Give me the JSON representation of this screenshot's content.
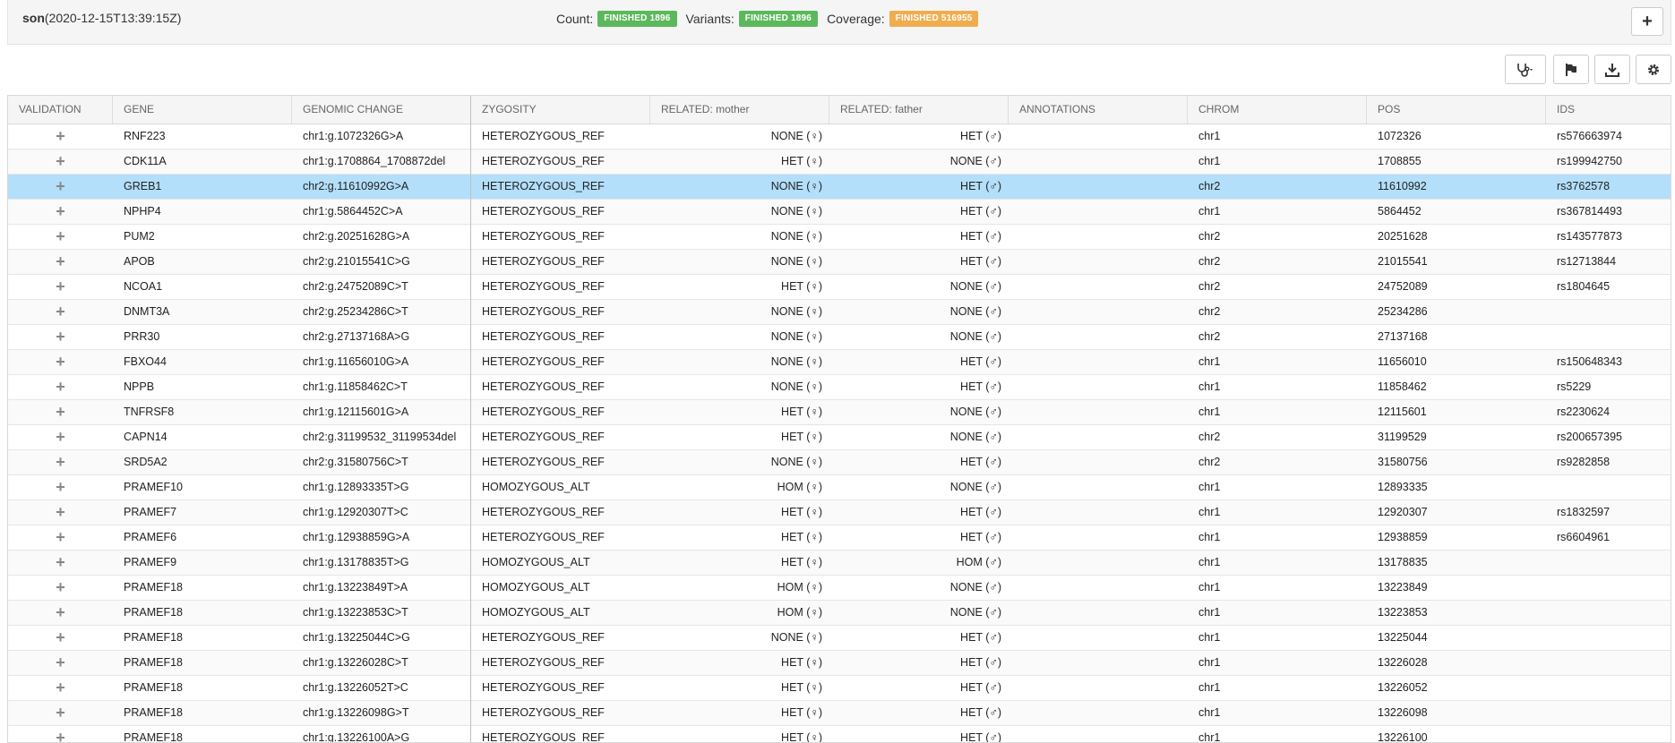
{
  "header": {
    "sample_name": "son",
    "sample_date": "(2020-12-15T13:39:15Z)",
    "statuses": [
      {
        "label": "Count:",
        "badge": "FINISHED 1896",
        "color": "#5cb85c"
      },
      {
        "label": "Variants:",
        "badge": "FINISHED 1896",
        "color": "#5cb85c"
      },
      {
        "label": "Coverage:",
        "badge": "FINISHED 516955",
        "color": "#f0ad4e"
      }
    ],
    "add_icon": "plus-icon"
  },
  "toolbar": {
    "buttons": [
      {
        "name": "stethoscope-dropdown-button",
        "icon": "stethoscope-icon"
      },
      {
        "name": "flag-button",
        "icon": "flag-icon"
      },
      {
        "name": "download-button",
        "icon": "download-icon"
      },
      {
        "name": "settings-button",
        "icon": "gear-icon"
      }
    ]
  },
  "table": {
    "columns": [
      "VALIDATION",
      "GENE",
      "GENOMIC CHANGE",
      "ZYGOSITY",
      "RELATED: mother",
      "RELATED: father",
      "ANNOTATIONS",
      "CHROM",
      "POS",
      "IDS"
    ],
    "selected_row": 2,
    "rows": [
      {
        "gene": "RNF223",
        "change": "chr1:g.1072326G>A",
        "zyg": "HETEROZYGOUS_REF",
        "mother": "NONE (♀)",
        "father": "HET (♂)",
        "chrom": "chr1",
        "pos": "1072326",
        "ids": "rs576663974"
      },
      {
        "gene": "CDK11A",
        "change": "chr1:g.1708864_1708872del",
        "zyg": "HETEROZYGOUS_REF",
        "mother": "HET (♀)",
        "father": "NONE (♂)",
        "chrom": "chr1",
        "pos": "1708855",
        "ids": "rs199942750"
      },
      {
        "gene": "GREB1",
        "change": "chr2:g.11610992G>A",
        "zyg": "HETEROZYGOUS_REF",
        "mother": "NONE (♀)",
        "father": "HET (♂)",
        "chrom": "chr2",
        "pos": "11610992",
        "ids": "rs3762578"
      },
      {
        "gene": "NPHP4",
        "change": "chr1:g.5864452C>A",
        "zyg": "HETEROZYGOUS_REF",
        "mother": "NONE (♀)",
        "father": "HET (♂)",
        "chrom": "chr1",
        "pos": "5864452",
        "ids": "rs367814493"
      },
      {
        "gene": "PUM2",
        "change": "chr2:g.20251628G>A",
        "zyg": "HETEROZYGOUS_REF",
        "mother": "NONE (♀)",
        "father": "HET (♂)",
        "chrom": "chr2",
        "pos": "20251628",
        "ids": "rs143577873"
      },
      {
        "gene": "APOB",
        "change": "chr2:g.21015541C>G",
        "zyg": "HETEROZYGOUS_REF",
        "mother": "NONE (♀)",
        "father": "HET (♂)",
        "chrom": "chr2",
        "pos": "21015541",
        "ids": "rs12713844"
      },
      {
        "gene": "NCOA1",
        "change": "chr2:g.24752089C>T",
        "zyg": "HETEROZYGOUS_REF",
        "mother": "HET (♀)",
        "father": "NONE (♂)",
        "chrom": "chr2",
        "pos": "24752089",
        "ids": "rs1804645"
      },
      {
        "gene": "DNMT3A",
        "change": "chr2:g.25234286C>T",
        "zyg": "HETEROZYGOUS_REF",
        "mother": "NONE (♀)",
        "father": "NONE (♂)",
        "chrom": "chr2",
        "pos": "25234286",
        "ids": ""
      },
      {
        "gene": "PRR30",
        "change": "chr2:g.27137168A>G",
        "zyg": "HETEROZYGOUS_REF",
        "mother": "NONE (♀)",
        "father": "NONE (♂)",
        "chrom": "chr2",
        "pos": "27137168",
        "ids": ""
      },
      {
        "gene": "FBXO44",
        "change": "chr1:g.11656010G>A",
        "zyg": "HETEROZYGOUS_REF",
        "mother": "NONE (♀)",
        "father": "HET (♂)",
        "chrom": "chr1",
        "pos": "11656010",
        "ids": "rs150648343"
      },
      {
        "gene": "NPPB",
        "change": "chr1:g.11858462C>T",
        "zyg": "HETEROZYGOUS_REF",
        "mother": "NONE (♀)",
        "father": "HET (♂)",
        "chrom": "chr1",
        "pos": "11858462",
        "ids": "rs5229"
      },
      {
        "gene": "TNFRSF8",
        "change": "chr1:g.12115601G>A",
        "zyg": "HETEROZYGOUS_REF",
        "mother": "HET (♀)",
        "father": "NONE (♂)",
        "chrom": "chr1",
        "pos": "12115601",
        "ids": "rs2230624"
      },
      {
        "gene": "CAPN14",
        "change": "chr2:g.31199532_31199534del",
        "zyg": "HETEROZYGOUS_REF",
        "mother": "HET (♀)",
        "father": "NONE (♂)",
        "chrom": "chr2",
        "pos": "31199529",
        "ids": "rs200657395"
      },
      {
        "gene": "SRD5A2",
        "change": "chr2:g.31580756C>T",
        "zyg": "HETEROZYGOUS_REF",
        "mother": "NONE (♀)",
        "father": "HET (♂)",
        "chrom": "chr2",
        "pos": "31580756",
        "ids": "rs9282858"
      },
      {
        "gene": "PRAMEF10",
        "change": "chr1:g.12893335T>G",
        "zyg": "HOMOZYGOUS_ALT",
        "mother": "HOM (♀)",
        "father": "NONE (♂)",
        "chrom": "chr1",
        "pos": "12893335",
        "ids": ""
      },
      {
        "gene": "PRAMEF7",
        "change": "chr1:g.12920307T>C",
        "zyg": "HETEROZYGOUS_REF",
        "mother": "HET (♀)",
        "father": "HET (♂)",
        "chrom": "chr1",
        "pos": "12920307",
        "ids": "rs1832597"
      },
      {
        "gene": "PRAMEF6",
        "change": "chr1:g.12938859G>A",
        "zyg": "HETEROZYGOUS_REF",
        "mother": "HET (♀)",
        "father": "HET (♂)",
        "chrom": "chr1",
        "pos": "12938859",
        "ids": "rs6604961"
      },
      {
        "gene": "PRAMEF9",
        "change": "chr1:g.13178835T>G",
        "zyg": "HOMOZYGOUS_ALT",
        "mother": "HET (♀)",
        "father": "HOM (♂)",
        "chrom": "chr1",
        "pos": "13178835",
        "ids": ""
      },
      {
        "gene": "PRAMEF18",
        "change": "chr1:g.13223849T>A",
        "zyg": "HOMOZYGOUS_ALT",
        "mother": "HOM (♀)",
        "father": "NONE (♂)",
        "chrom": "chr1",
        "pos": "13223849",
        "ids": ""
      },
      {
        "gene": "PRAMEF18",
        "change": "chr1:g.13223853C>T",
        "zyg": "HOMOZYGOUS_ALT",
        "mother": "HOM (♀)",
        "father": "NONE (♂)",
        "chrom": "chr1",
        "pos": "13223853",
        "ids": ""
      },
      {
        "gene": "PRAMEF18",
        "change": "chr1:g.13225044C>G",
        "zyg": "HETEROZYGOUS_REF",
        "mother": "NONE (♀)",
        "father": "HET (♂)",
        "chrom": "chr1",
        "pos": "13225044",
        "ids": ""
      },
      {
        "gene": "PRAMEF18",
        "change": "chr1:g.13226028C>T",
        "zyg": "HETEROZYGOUS_REF",
        "mother": "HET (♀)",
        "father": "HET (♂)",
        "chrom": "chr1",
        "pos": "13226028",
        "ids": ""
      },
      {
        "gene": "PRAMEF18",
        "change": "chr1:g.13226052T>C",
        "zyg": "HETEROZYGOUS_REF",
        "mother": "HET (♀)",
        "father": "HET (♂)",
        "chrom": "chr1",
        "pos": "13226052",
        "ids": ""
      },
      {
        "gene": "PRAMEF18",
        "change": "chr1:g.13226098G>T",
        "zyg": "HETEROZYGOUS_REF",
        "mother": "HET (♀)",
        "father": "HET (♂)",
        "chrom": "chr1",
        "pos": "13226098",
        "ids": ""
      },
      {
        "gene": "PRAMEF18",
        "change": "chr1:g.13226100A>G",
        "zyg": "HETEROZYGOUS_REF",
        "mother": "HET (♀)",
        "father": "HET (♂)",
        "chrom": "chr1",
        "pos": "13226100",
        "ids": ""
      }
    ]
  }
}
